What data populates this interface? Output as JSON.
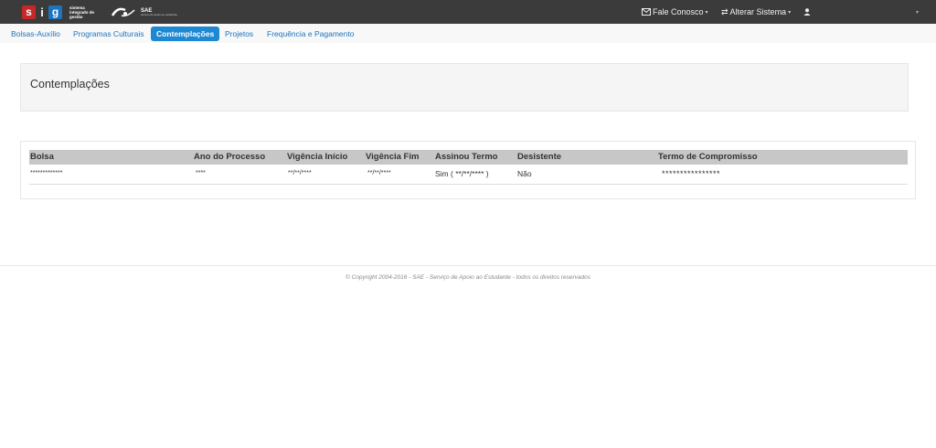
{
  "header": {
    "logo_sig": {
      "letters": [
        "s",
        "i",
        "g"
      ],
      "subtitle": "sistema integrado de gestão"
    },
    "logo_sae": {
      "title": "SAE",
      "subtitle": "serviço de apoio ao estudante"
    },
    "contact_label": "Fale Conosco",
    "change_system_label": "Alterar Sistema",
    "icons": {
      "contact": "envelope-icon",
      "change_system": "exchange-icon",
      "user": "user-icon",
      "caret": "caret-down-icon"
    }
  },
  "nav": {
    "items": [
      {
        "label": "Bolsas-Auxílio",
        "active": false
      },
      {
        "label": "Programas Culturais",
        "active": false
      },
      {
        "label": "Contemplações",
        "active": true
      },
      {
        "label": "Projetos",
        "active": false
      },
      {
        "label": "Frequência e Pagamento",
        "active": false
      }
    ]
  },
  "page": {
    "title": "Contemplações"
  },
  "table": {
    "headers": [
      "Bolsa",
      "Ano do Processo",
      "Vigência Início",
      "Vigência Fim",
      "Assinou Termo",
      "Desistente",
      "Termo de Compromisso"
    ],
    "rows": [
      [
        "*************",
        "****",
        "**/**/****",
        "**/**/****",
        "Sim ( **/**/**** )",
        "Não",
        "****************"
      ]
    ]
  },
  "footer": {
    "text": "© Copyright 2004-2016 - SAE - Serviço de Apoio ao Estudante - todos os direitos reservados"
  },
  "colors": {
    "topbar": "#3b3b3b",
    "accent": "#1e88d2",
    "link": "#1e73be",
    "table_header": "#c7c7c7"
  }
}
